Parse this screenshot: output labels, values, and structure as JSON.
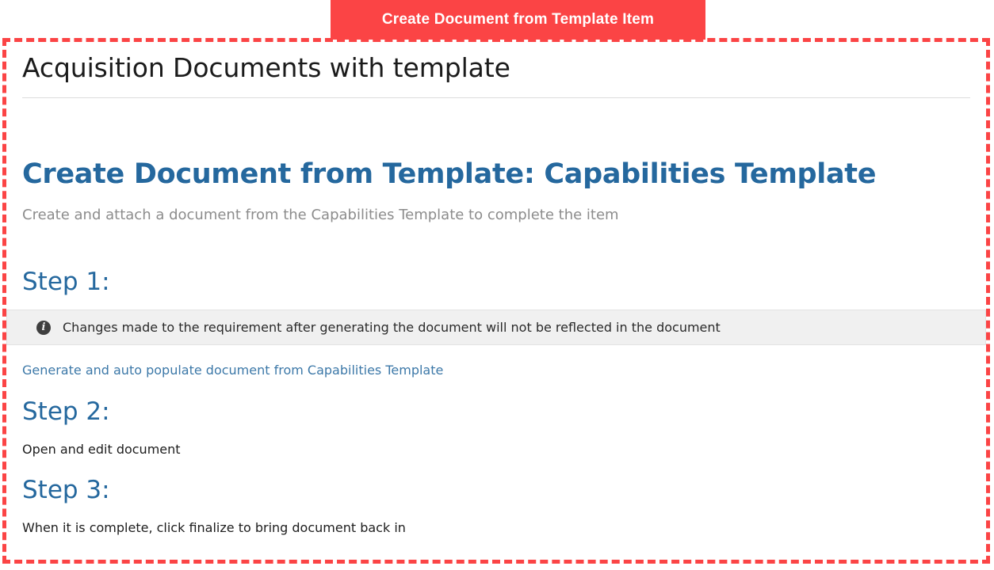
{
  "callout": {
    "label": "Create Document from  Template Item",
    "color": "#fb4445"
  },
  "highlight": {
    "border_color": "#fb4445",
    "style": "dashed"
  },
  "page": {
    "title": "Acquisition Documents with template",
    "section": {
      "heading": "Create Document from Template: Capabilities Template",
      "subtitle": "Create and attach a document from the Capabilities Template to complete the item",
      "heading_color": "#25689e"
    },
    "steps": [
      {
        "heading": "Step 1:",
        "alert": {
          "icon": "info-circle-icon",
          "icon_glyph": "i",
          "text": "Changes made to the requirement after generating the document will not be reflected in the document"
        },
        "link": "Generate and auto populate document from Capabilities Template"
      },
      {
        "heading": "Step 2:",
        "text": "Open and edit document"
      },
      {
        "heading": "Step 3:",
        "text": "When it is complete, click finalize to bring document back in"
      }
    ]
  }
}
